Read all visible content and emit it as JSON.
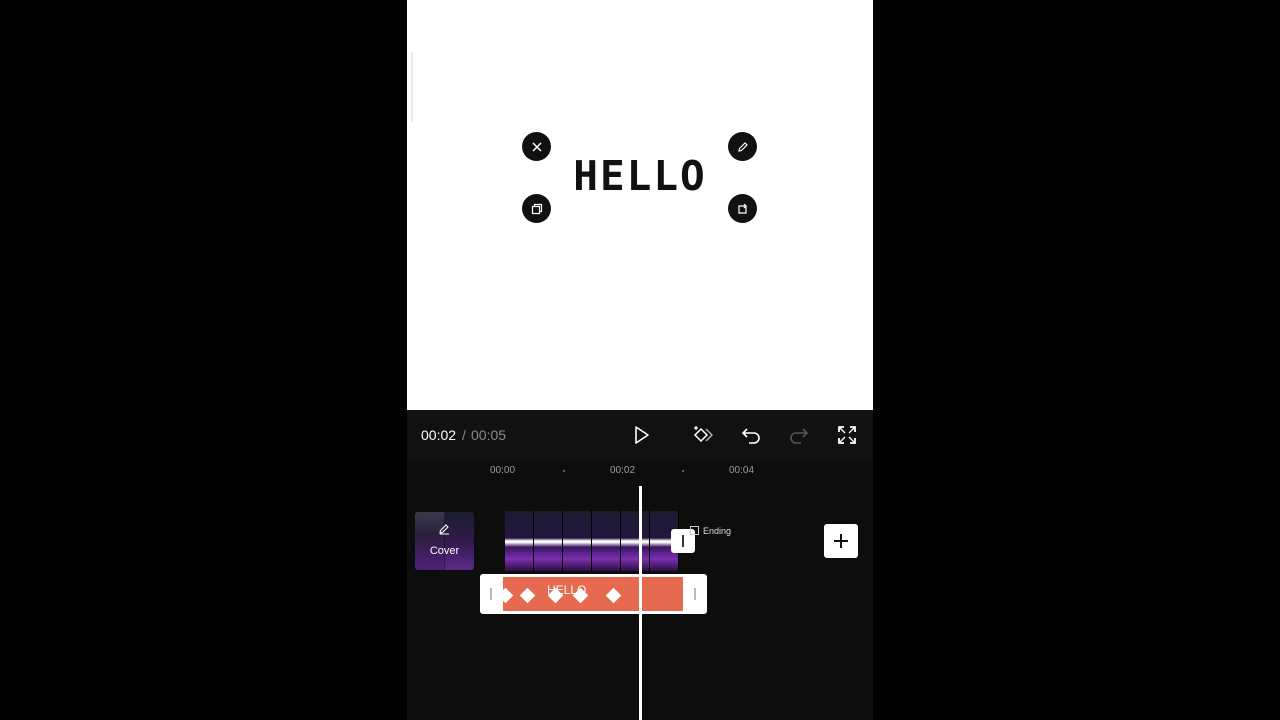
{
  "canvas": {
    "text_overlay": "HELLO",
    "handles": [
      "close-icon",
      "edit-icon",
      "copy-icon",
      "rotate-icon"
    ]
  },
  "toolbar": {
    "current_time": "00:02",
    "separator": "/",
    "total_time": "00:05",
    "icons": [
      "play-icon",
      "keyframe-icon",
      "undo-icon",
      "redo-icon",
      "fullscreen-icon"
    ]
  },
  "ruler": {
    "labels": [
      "00:00",
      "00:02",
      "00:04"
    ]
  },
  "timeline": {
    "cover_label": "Cover",
    "ending_label": "Ending",
    "text_track_label": "HELLO",
    "add_icon": "plus-icon"
  },
  "colors": {
    "text_track": "#e56a4f",
    "playhead": "#ffffff",
    "background": "#0d0d0d"
  }
}
